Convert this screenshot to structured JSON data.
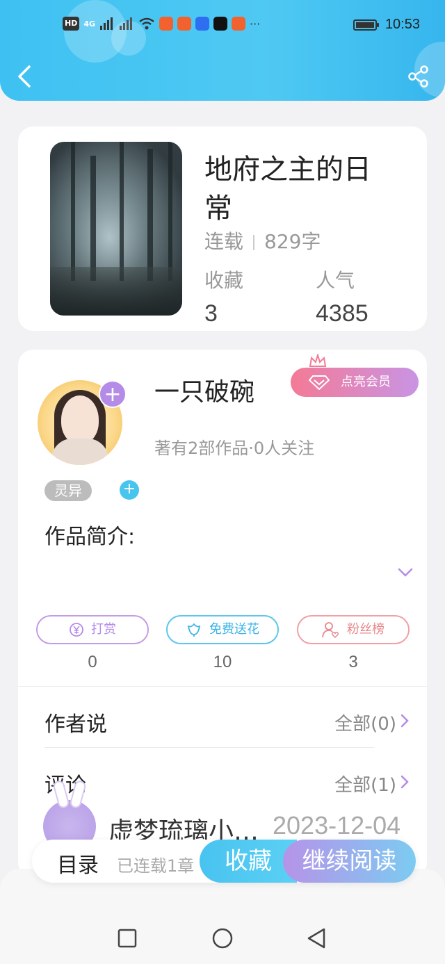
{
  "status_bar": {
    "network_label": "HD",
    "signal_label": "4G",
    "more": "···",
    "time": "10:53"
  },
  "header": {
    "back_icon": "back-arrow-icon",
    "share_icon": "share-icon"
  },
  "book": {
    "title": "地府之主的日常",
    "status": "连载",
    "word_count": "829字",
    "favorites_label": "收藏",
    "favorites_value": "3",
    "popularity_label": "人气",
    "popularity_value": "4385"
  },
  "author": {
    "name": "一只破碗",
    "vip_button": "点亮会员",
    "meta": "著有2部作品·0人关注",
    "tag": "灵异",
    "intro_title": "作品简介:"
  },
  "actions": [
    {
      "label": "打赏",
      "count": "0",
      "color": "#b58be8"
    },
    {
      "label": "免费送花",
      "count": "10",
      "color": "#3cb4e6"
    },
    {
      "label": "粉丝榜",
      "count": "3",
      "color": "#e8878c"
    }
  ],
  "author_says": {
    "title": "作者说",
    "link": "全部(0)"
  },
  "comments": {
    "title": "评论",
    "link": "全部(1)",
    "first_user": "虚梦琉璃小…",
    "first_date": "2023-12-04"
  },
  "bottom_bar": {
    "catalog": "目录",
    "catalog_status": "已连载1章",
    "collect": "收藏",
    "continue_reading": "继续阅读"
  },
  "navigation": {
    "recent_icon": "square-icon",
    "home_icon": "circle-icon",
    "back_icon": "triangle-back-icon"
  }
}
